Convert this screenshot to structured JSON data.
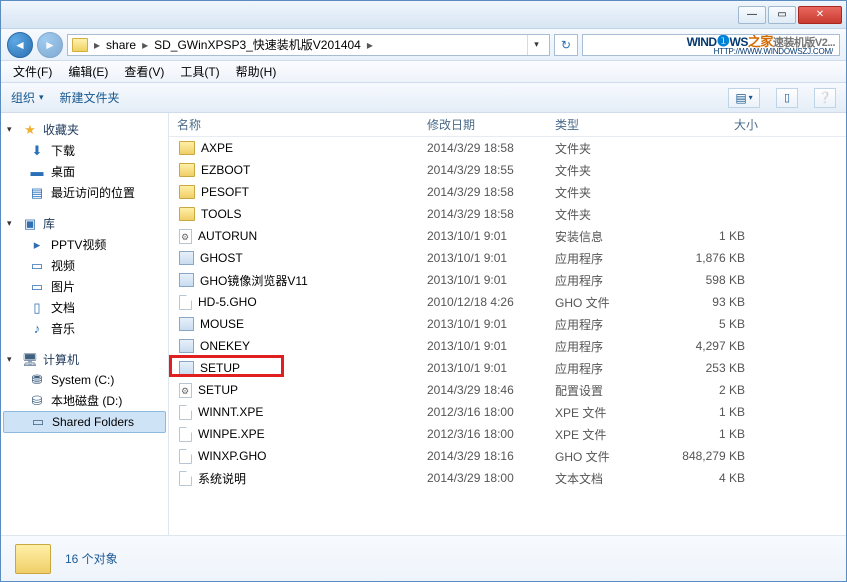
{
  "titlebar": {
    "min": "—",
    "max": "▭",
    "close": "✕"
  },
  "nav": {
    "back": "◄",
    "fwd": "►",
    "refresh": "↻"
  },
  "breadcrumbs": [
    "share",
    "SD_GWinXPSP3_快速装机版V201404"
  ],
  "breadcrumb_sep": "▸",
  "search": {
    "watermark_win": "WIND",
    "watermark_globe": "❶",
    "watermark_ws": "WS",
    "watermark_zj": "之家",
    "watermark_tail": "速装机版V2...",
    "watermark_url": "HTTP://WWW.WINDOWSZJ.COM/"
  },
  "menus": [
    {
      "label": "文件(F)"
    },
    {
      "label": "编辑(E)"
    },
    {
      "label": "查看(V)"
    },
    {
      "label": "工具(T)"
    },
    {
      "label": "帮助(H)"
    }
  ],
  "toolbar": {
    "organize": "组织",
    "newfolder": "新建文件夹",
    "dd": "▾",
    "views": "▤",
    "help": "❔"
  },
  "sidebar": {
    "fav_head": "收藏夹",
    "favs": [
      {
        "icon": "download-icon",
        "glyph": "⬇",
        "label": "下载"
      },
      {
        "icon": "desktop-icon",
        "glyph": "▬",
        "label": "桌面"
      },
      {
        "icon": "recent-icon",
        "glyph": "▤",
        "label": "最近访问的位置"
      }
    ],
    "lib_head": "库",
    "libs": [
      {
        "icon": "pptv-icon",
        "glyph": "▸",
        "label": "PPTV视频"
      },
      {
        "icon": "video-icon",
        "glyph": "▭",
        "label": "视频"
      },
      {
        "icon": "picture-icon",
        "glyph": "▭",
        "label": "图片"
      },
      {
        "icon": "document-icon",
        "glyph": "▯",
        "label": "文档"
      },
      {
        "icon": "music-icon",
        "glyph": "♪",
        "label": "音乐"
      }
    ],
    "comp_head": "计算机",
    "drives": [
      {
        "icon": "drive-c-icon",
        "glyph": "⛃",
        "label": "System (C:)"
      },
      {
        "icon": "drive-d-icon",
        "glyph": "⛁",
        "label": "本地磁盘 (D:)"
      },
      {
        "icon": "shared-folders-icon",
        "glyph": "▭",
        "label": "Shared Folders",
        "selected": true
      }
    ],
    "twisty_open": "▾",
    "twisty_closed": "▸"
  },
  "columns": {
    "name": "名称",
    "date": "修改日期",
    "type": "类型",
    "size": "大小"
  },
  "files": [
    {
      "icon": "folder",
      "name": "AXPE",
      "date": "2014/3/29 18:58",
      "type": "文件夹",
      "size": ""
    },
    {
      "icon": "folder",
      "name": "EZBOOT",
      "date": "2014/3/29 18:55",
      "type": "文件夹",
      "size": ""
    },
    {
      "icon": "folder",
      "name": "PESOFT",
      "date": "2014/3/29 18:58",
      "type": "文件夹",
      "size": ""
    },
    {
      "icon": "folder",
      "name": "TOOLS",
      "date": "2014/3/29 18:58",
      "type": "文件夹",
      "size": ""
    },
    {
      "icon": "cfg",
      "name": "AUTORUN",
      "date": "2013/10/1 9:01",
      "type": "安装信息",
      "size": "1 KB"
    },
    {
      "icon": "exe",
      "name": "GHOST",
      "date": "2013/10/1 9:01",
      "type": "应用程序",
      "size": "1,876 KB"
    },
    {
      "icon": "exe",
      "name": "GHO镜像浏览器V11",
      "date": "2013/10/1 9:01",
      "type": "应用程序",
      "size": "598 KB"
    },
    {
      "icon": "file",
      "name": "HD-5.GHO",
      "date": "2010/12/18 4:26",
      "type": "GHO 文件",
      "size": "93 KB"
    },
    {
      "icon": "exe",
      "name": "MOUSE",
      "date": "2013/10/1 9:01",
      "type": "应用程序",
      "size": "5 KB"
    },
    {
      "icon": "exe",
      "name": "ONEKEY",
      "date": "2013/10/1 9:01",
      "type": "应用程序",
      "size": "4,297 KB"
    },
    {
      "icon": "exe",
      "name": "SETUP",
      "date": "2013/10/1 9:01",
      "type": "应用程序",
      "size": "253 KB",
      "highlight": true
    },
    {
      "icon": "cfg",
      "name": "SETUP",
      "date": "2014/3/29 18:46",
      "type": "配置设置",
      "size": "2 KB"
    },
    {
      "icon": "file",
      "name": "WINNT.XPE",
      "date": "2012/3/16 18:00",
      "type": "XPE 文件",
      "size": "1 KB"
    },
    {
      "icon": "file",
      "name": "WINPE.XPE",
      "date": "2012/3/16 18:00",
      "type": "XPE 文件",
      "size": "1 KB"
    },
    {
      "icon": "file",
      "name": "WINXP.GHO",
      "date": "2014/3/29 18:16",
      "type": "GHO 文件",
      "size": "848,279 KB"
    },
    {
      "icon": "file",
      "name": "系统说明",
      "date": "2014/3/29 18:00",
      "type": "文本文档",
      "size": "4 KB"
    }
  ],
  "status": {
    "count": "16 个对象"
  }
}
